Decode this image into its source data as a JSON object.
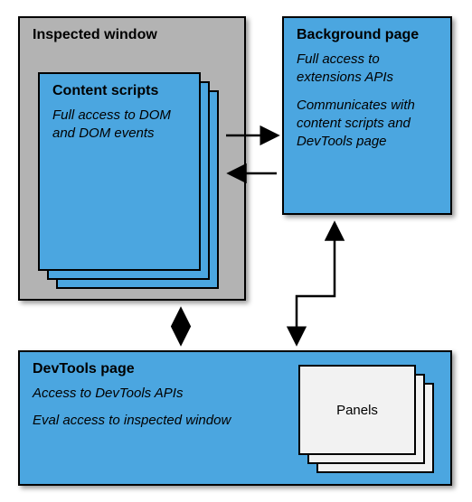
{
  "inspected": {
    "title": "Inspected window"
  },
  "content_scripts": {
    "title": "Content scripts",
    "desc": "Full access to DOM and DOM events"
  },
  "background": {
    "title": "Background page",
    "desc1": "Full access to extensions APIs",
    "desc2": "Communicates with content scripts and DevTools page"
  },
  "devtools": {
    "title": "DevTools page",
    "desc1": "Access to DevTools APIs",
    "desc2": "Eval access to inspected window"
  },
  "panels": {
    "label": "Panels"
  }
}
